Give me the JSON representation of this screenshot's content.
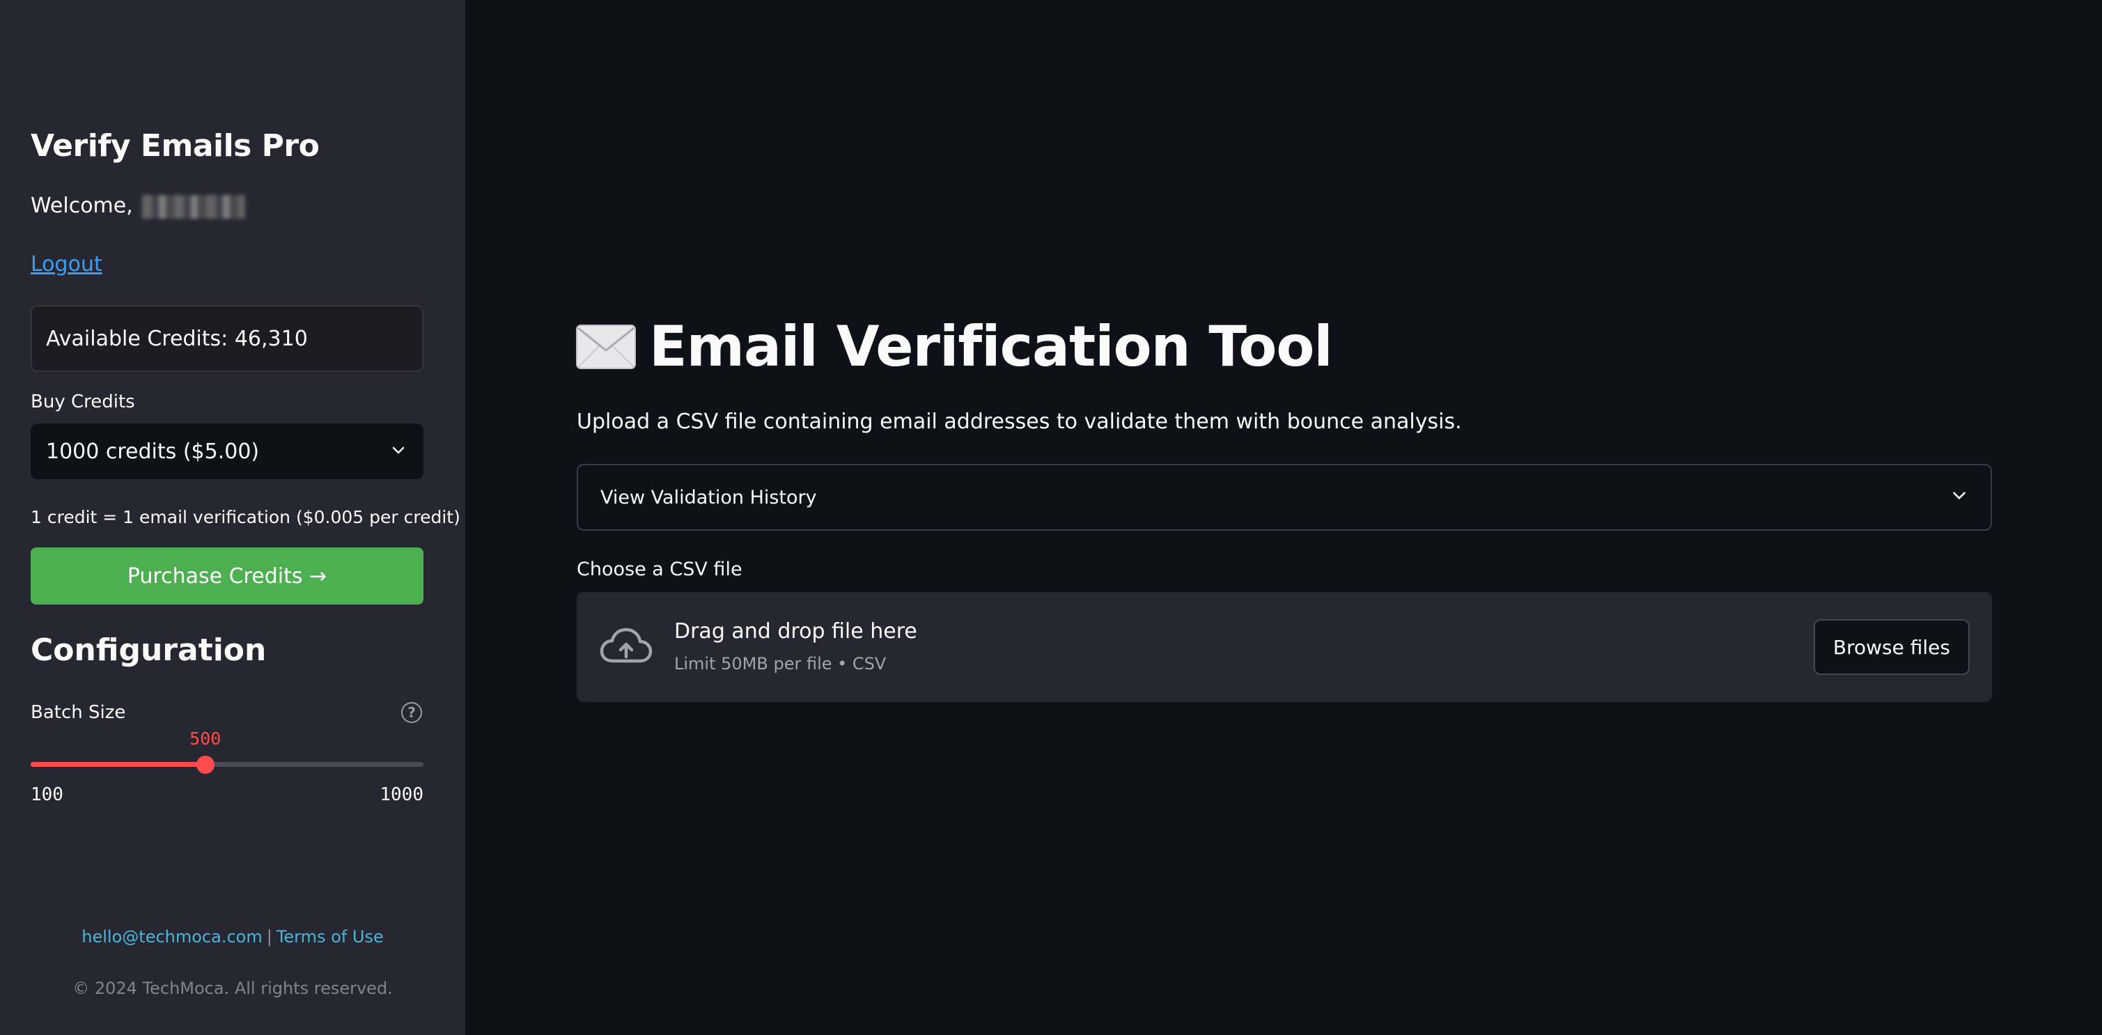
{
  "sidebar": {
    "app_title": "Verify Emails Pro",
    "welcome_prefix": "Welcome,",
    "logout_label": "Logout",
    "available_credits": "Available Credits: 46,310",
    "buy_credits_label": "Buy Credits",
    "buy_credits_selected": "1000 credits ($5.00)",
    "credit_note": "1 credit = 1 email verification ($0.005 per credit)",
    "purchase_button": "Purchase Credits →",
    "configuration_title": "Configuration",
    "batch_size": {
      "label": "Batch Size",
      "value": "500",
      "min": "100",
      "max": "1000",
      "value_num": 500,
      "min_num": 100,
      "max_num": 1000
    },
    "footer": {
      "email": "hello@techmoca.com",
      "separator": "|",
      "terms": "Terms of Use",
      "copyright": "© 2024 TechMoca. All rights reserved."
    }
  },
  "main": {
    "title": "Email Verification Tool",
    "subtitle": "Upload a CSV file containing email addresses to validate them with bounce analysis.",
    "history_expander": "View Validation History",
    "file_label": "Choose a CSV file",
    "dropzone": {
      "title": "Drag and drop file here",
      "limit": "Limit 50MB per file • CSV",
      "browse_button": "Browse files"
    }
  },
  "colors": {
    "sidebar_bg": "#262730",
    "main_bg": "#0e1117",
    "accent_red": "#ff4b4b",
    "purchase_green": "#4caf50",
    "link_blue": "#3d9df3",
    "footer_link": "#4ab5d9"
  },
  "icons": [
    "envelope-icon",
    "chevron-down-icon",
    "help-circle-icon",
    "cloud-upload-icon"
  ]
}
